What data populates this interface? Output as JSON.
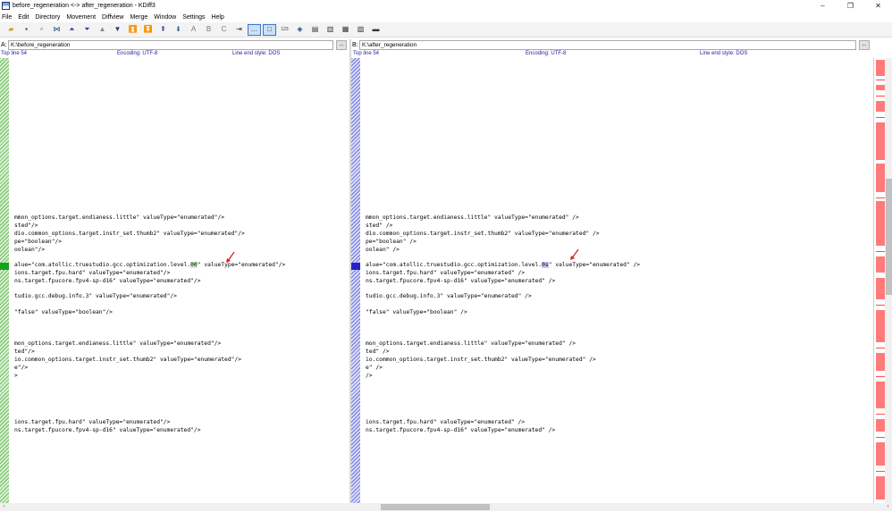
{
  "window": {
    "title": "before_regeneration <-> after_regeneration - KDiff3",
    "controls": [
      "–",
      "❐",
      "✕"
    ]
  },
  "menu": [
    "File",
    "Edit",
    "Directory",
    "Movement",
    "Diffview",
    "Merge",
    "Window",
    "Settings",
    "Help"
  ],
  "toolbar": {
    "number_label": "123",
    "a_label": "A",
    "b_label": "B",
    "c_label": "C"
  },
  "pane_a": {
    "label": "A:",
    "path": "K:\\before_regeneration",
    "browse": "...",
    "top_line": "Top line 54",
    "encoding": "Encoding: UTF-8",
    "line_end": "Line end style: DOS",
    "lines": [
      {
        "text": "mmon_options.target.endianess.little\" valueType=\"enumerated\"/>"
      },
      {
        "text": "sted\"/>"
      },
      {
        "text": "dio.common_options.target.instr_set.thumb2\" valueType=\"enumerated\"/>"
      },
      {
        "text": "pe=\"boolean\"/>"
      },
      {
        "text": "oolean\"/>"
      },
      {
        "before": "alue=\"com.atollic.truestudio.gcc.optimization.level.",
        "diff": "00",
        "after": "\" valueType=\"enumerated\"/>"
      },
      {
        "text": "ions.target.fpu.hard\" valueType=\"enumerated\"/>"
      },
      {
        "text": "ns.target.fpucore.fpv4-sp-d16\" valueType=\"enumerated\"/>"
      },
      {
        "text": "tudio.gcc.debug.info.3\" valueType=\"enumerated\"/>"
      },
      {
        "text": "\"false\" valueType=\"boolean\"/>"
      },
      {
        "text": "mon_options.target.endianess.little\" valueType=\"enumerated\"/>"
      },
      {
        "text": "ted\"/>"
      },
      {
        "text": "io.common_options.target.instr_set.thumb2\" valueType=\"enumerated\"/>"
      },
      {
        "text": "e\"/>"
      },
      {
        "text": ">"
      },
      {
        "text": "ions.target.fpu.hard\" valueType=\"enumerated\"/>"
      },
      {
        "text": "ns.target.fpucore.fpv4-sp-d16\" valueType=\"enumerated\"/>"
      }
    ]
  },
  "pane_b": {
    "label": "B:",
    "path": "K:\\after_regeneration",
    "browse": "...",
    "top_line": "Top line 54",
    "encoding": "Encoding: UTF-8",
    "line_end": "Line end style: DOS",
    "lines": [
      {
        "text": "mmon_options.target.endianess.little\" valueType=\"enumerated\" />"
      },
      {
        "text": "sted\" />"
      },
      {
        "text": "dio.common_options.target.instr_set.thumb2\" valueType=\"enumerated\" />"
      },
      {
        "text": "pe=\"boolean\" />"
      },
      {
        "text": "oolean\" />"
      },
      {
        "before": "alue=\"com.atollic.truestudio.gcc.optimization.level.",
        "diff": "0s",
        "after": "\" valueType=\"enumerated\" />"
      },
      {
        "text": "ions.target.fpu.hard\" valueType=\"enumerated\" />"
      },
      {
        "text": "ns.target.fpucore.fpv4-sp-d16\" valueType=\"enumerated\" />"
      },
      {
        "text": "tudio.gcc.debug.info.3\" valueType=\"enumerated\" />"
      },
      {
        "text": "\"false\" valueType=\"boolean\" />"
      },
      {
        "text": "mon_options.target.endianess.little\" valueType=\"enumerated\" />"
      },
      {
        "text": "ted\" />"
      },
      {
        "text": "io.common_options.target.instr_set.thumb2\" valueType=\"enumerated\" />"
      },
      {
        "text": "e\" />"
      },
      {
        "text": "/>"
      },
      {
        "text": "ions.target.fpu.hard\" valueType=\"enumerated\" />"
      },
      {
        "text": "ns.target.fpucore.fpv4-sp-d16\" valueType=\"enumerated\" />"
      }
    ]
  },
  "colors": {
    "pane_a_diff": "#12a31b",
    "pane_b_diff": "#2323c9",
    "overview_diff": "#ff7b7b",
    "arrow": "#e0201a",
    "info_text": "#1d1d9d"
  }
}
